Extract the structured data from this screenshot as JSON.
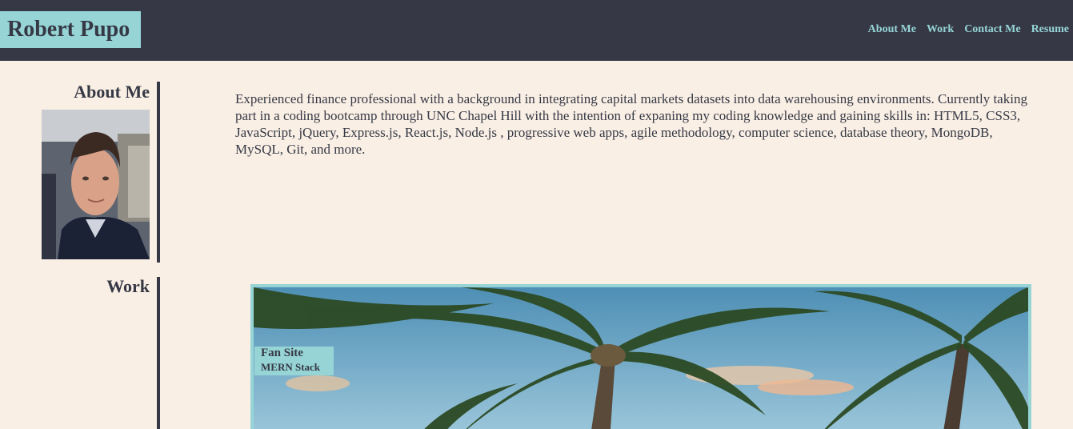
{
  "header": {
    "brand": "Robert Pupo",
    "nav": [
      "About Me",
      "Work",
      "Contact Me",
      "Resume"
    ]
  },
  "about": {
    "heading": "About Me",
    "photo_icon": "profile-photo",
    "text": "Experienced finance professional with a background in integrating capital markets datasets into data warehousing environments. Currently taking part in a coding bootcamp through UNC Chapel Hill with the intention of expaning my coding knowledge and gaining skills in: HTML5, CSS3, JavaScript, jQuery, Express.js, React.js, Node.js , progressive web apps, agile methodology, computer science, database theory, MongoDB, MySQL, Git, and more."
  },
  "work": {
    "heading": "Work",
    "projects": [
      {
        "title": "Fan Site",
        "subtitle": "MERN Stack",
        "image_icon": "palm-trees-image"
      }
    ]
  },
  "colors": {
    "header_bg": "#363945",
    "accent": "#96d4d6",
    "page_bg": "#f9efe5",
    "text": "#363945"
  }
}
